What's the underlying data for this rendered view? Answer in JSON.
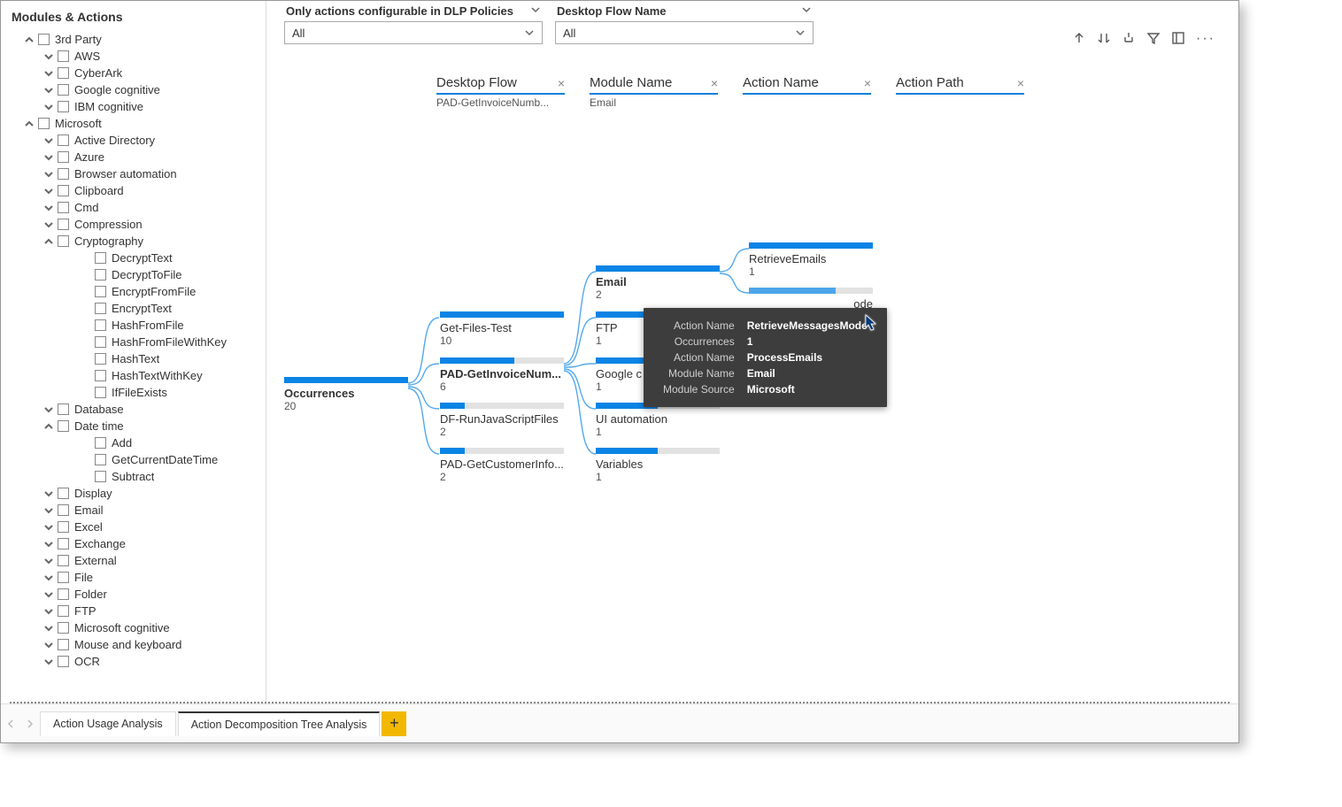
{
  "sidebar": {
    "title": "Modules & Actions",
    "tree": [
      {
        "label": "3rd Party",
        "level": 0,
        "expanded": true
      },
      {
        "label": "AWS",
        "level": 1,
        "expanded": false
      },
      {
        "label": "CyberArk",
        "level": 1,
        "expanded": false
      },
      {
        "label": "Google cognitive",
        "level": 1,
        "expanded": false
      },
      {
        "label": "IBM cognitive",
        "level": 1,
        "expanded": false
      },
      {
        "label": "Microsoft",
        "level": 0,
        "expanded": true
      },
      {
        "label": "Active Directory",
        "level": 1,
        "expanded": false
      },
      {
        "label": "Azure",
        "level": 1,
        "expanded": false
      },
      {
        "label": "Browser automation",
        "level": 1,
        "expanded": false
      },
      {
        "label": "Clipboard",
        "level": 1,
        "expanded": false
      },
      {
        "label": "Cmd",
        "level": 1,
        "expanded": false
      },
      {
        "label": "Compression",
        "level": 1,
        "expanded": false
      },
      {
        "label": "Cryptography",
        "level": 1,
        "expanded": true
      },
      {
        "label": "DecryptText",
        "level": 2
      },
      {
        "label": "DecryptToFile",
        "level": 2
      },
      {
        "label": "EncryptFromFile",
        "level": 2
      },
      {
        "label": "EncryptText",
        "level": 2
      },
      {
        "label": "HashFromFile",
        "level": 2
      },
      {
        "label": "HashFromFileWithKey",
        "level": 2
      },
      {
        "label": "HashText",
        "level": 2
      },
      {
        "label": "HashTextWithKey",
        "level": 2
      },
      {
        "label": "IfFileExists",
        "level": 2
      },
      {
        "label": "Database",
        "level": 1,
        "expanded": false
      },
      {
        "label": "Date time",
        "level": 1,
        "expanded": true
      },
      {
        "label": "Add",
        "level": 2
      },
      {
        "label": "GetCurrentDateTime",
        "level": 2
      },
      {
        "label": "Subtract",
        "level": 2
      },
      {
        "label": "Display",
        "level": 1,
        "expanded": false
      },
      {
        "label": "Email",
        "level": 1,
        "expanded": false
      },
      {
        "label": "Excel",
        "level": 1,
        "expanded": false
      },
      {
        "label": "Exchange",
        "level": 1,
        "expanded": false
      },
      {
        "label": "External",
        "level": 1,
        "expanded": false
      },
      {
        "label": "File",
        "level": 1,
        "expanded": false
      },
      {
        "label": "Folder",
        "level": 1,
        "expanded": false
      },
      {
        "label": "FTP",
        "level": 1,
        "expanded": false
      },
      {
        "label": "Microsoft cognitive",
        "level": 1,
        "expanded": false
      },
      {
        "label": "Mouse and keyboard",
        "level": 1,
        "expanded": false
      },
      {
        "label": "OCR",
        "level": 1,
        "expanded": false
      }
    ]
  },
  "filters": {
    "dlp": {
      "title": "Only actions configurable in DLP Policies",
      "value": "All"
    },
    "flow": {
      "title": "Desktop Flow Name",
      "value": "All"
    }
  },
  "headers": {
    "h0": {
      "label": "Desktop Flow",
      "sub": "PAD-GetInvoiceNumb..."
    },
    "h1": {
      "label": "Module Name",
      "sub": "Email"
    },
    "h2": {
      "label": "Action Name",
      "sub": ""
    },
    "h3": {
      "label": "Action Path",
      "sub": ""
    }
  },
  "root": {
    "title": "Occurrences",
    "count": "20"
  },
  "flows": {
    "f0": {
      "title": "Get-Files-Test",
      "count": "10",
      "fill": 100
    },
    "f1": {
      "title": "PAD-GetInvoiceNum...",
      "count": "6",
      "fill": 60
    },
    "f2": {
      "title": "DF-RunJavaScriptFiles",
      "count": "2",
      "fill": 20
    },
    "f3": {
      "title": "PAD-GetCustomerInfo...",
      "count": "2",
      "fill": 20
    }
  },
  "modules": {
    "m0": {
      "title": "Email",
      "count": "2",
      "fill": 100
    },
    "m1": {
      "title": "FTP",
      "count": "1",
      "fill": 50
    },
    "m2": {
      "title": "Google c",
      "count": "1",
      "fill": 50
    },
    "m3": {
      "title": "UI automation",
      "count": "1",
      "fill": 50
    },
    "m4": {
      "title": "Variables",
      "count": "1",
      "fill": 50
    }
  },
  "actions": {
    "a0": {
      "title": "RetrieveEmails",
      "count": "1",
      "fill": 100
    },
    "a1": {
      "title_tail": "ode",
      "count": "1",
      "fill": 70
    }
  },
  "tooltip": {
    "r0k": "Action Name",
    "r0v": "RetrieveMessagesMode",
    "r1k": "Occurrences",
    "r1v": "1",
    "r2k": "Action Name",
    "r2v": "ProcessEmails",
    "r3k": "Module Name",
    "r3v": "Email",
    "r4k": "Module Source",
    "r4v": "Microsoft"
  },
  "tabs": {
    "t0": "Action Usage Analysis",
    "t1": "Action Decomposition Tree Analysis"
  }
}
